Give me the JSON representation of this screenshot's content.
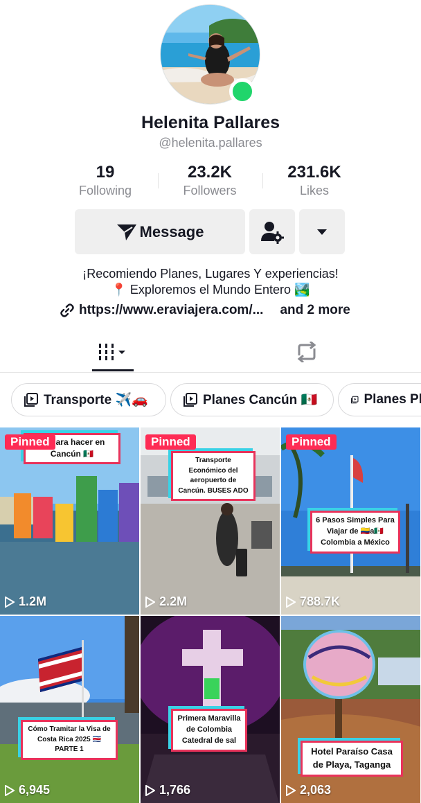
{
  "profile": {
    "name": "Helenita Pallares",
    "handle": "@helenita.pallares",
    "online": true
  },
  "stats": [
    {
      "value": "19",
      "label": "Following"
    },
    {
      "value": "23.2K",
      "label": "Followers"
    },
    {
      "value": "231.6K",
      "label": "Likes"
    }
  ],
  "actions": {
    "message_label": "Message",
    "follow_icon": "person-gear-icon",
    "more_icon": "caret-down-icon"
  },
  "bio": {
    "line1": "¡Recomiendo Planes, Lugares Y experiencias!",
    "line2": "📍 Exploremos el Mundo Entero 🏞️",
    "link": "https://www.eraviajera.com/...",
    "more": "and 2 more"
  },
  "tabs": [
    {
      "name": "videos-grid",
      "icon": "grid-icon",
      "active": true
    },
    {
      "name": "reposts",
      "icon": "repost-icon",
      "active": false
    }
  ],
  "playlists": [
    {
      "label": "Transporte ✈️🚗"
    },
    {
      "label": "Planes Cancún 🇲🇽"
    },
    {
      "label": "Planes Pl"
    }
  ],
  "videos": [
    {
      "pinned": "Pinned",
      "caption": "es para hacer en Cancún 🇲🇽",
      "views": "1.2M"
    },
    {
      "pinned": "Pinned",
      "caption": "Transporte Económico del aeropuerto de Cancún. BUSES ADO",
      "views": "2.2M"
    },
    {
      "pinned": "Pinned",
      "caption": "6 Pasos Simples Para Viajar de 🇨🇴a🇲🇽 Colombia a México",
      "views": "788.7K"
    },
    {
      "pinned": "",
      "caption": "Cómo Tramitar la Visa de Costa Rica 2025 🇨🇷 PARTE 1",
      "views": "6,945"
    },
    {
      "pinned": "",
      "caption": "Primera Maravilla de Colombia Catedral de sal",
      "views": "1,766"
    },
    {
      "pinned": "",
      "caption": "Hotel Paraíso Casa de Playa, Taganga",
      "views": "2,063"
    }
  ],
  "colors": {
    "accent": "#fe2c55",
    "online": "#20d56b",
    "muted": "#8a8b91",
    "button_bg": "#efefef"
  }
}
